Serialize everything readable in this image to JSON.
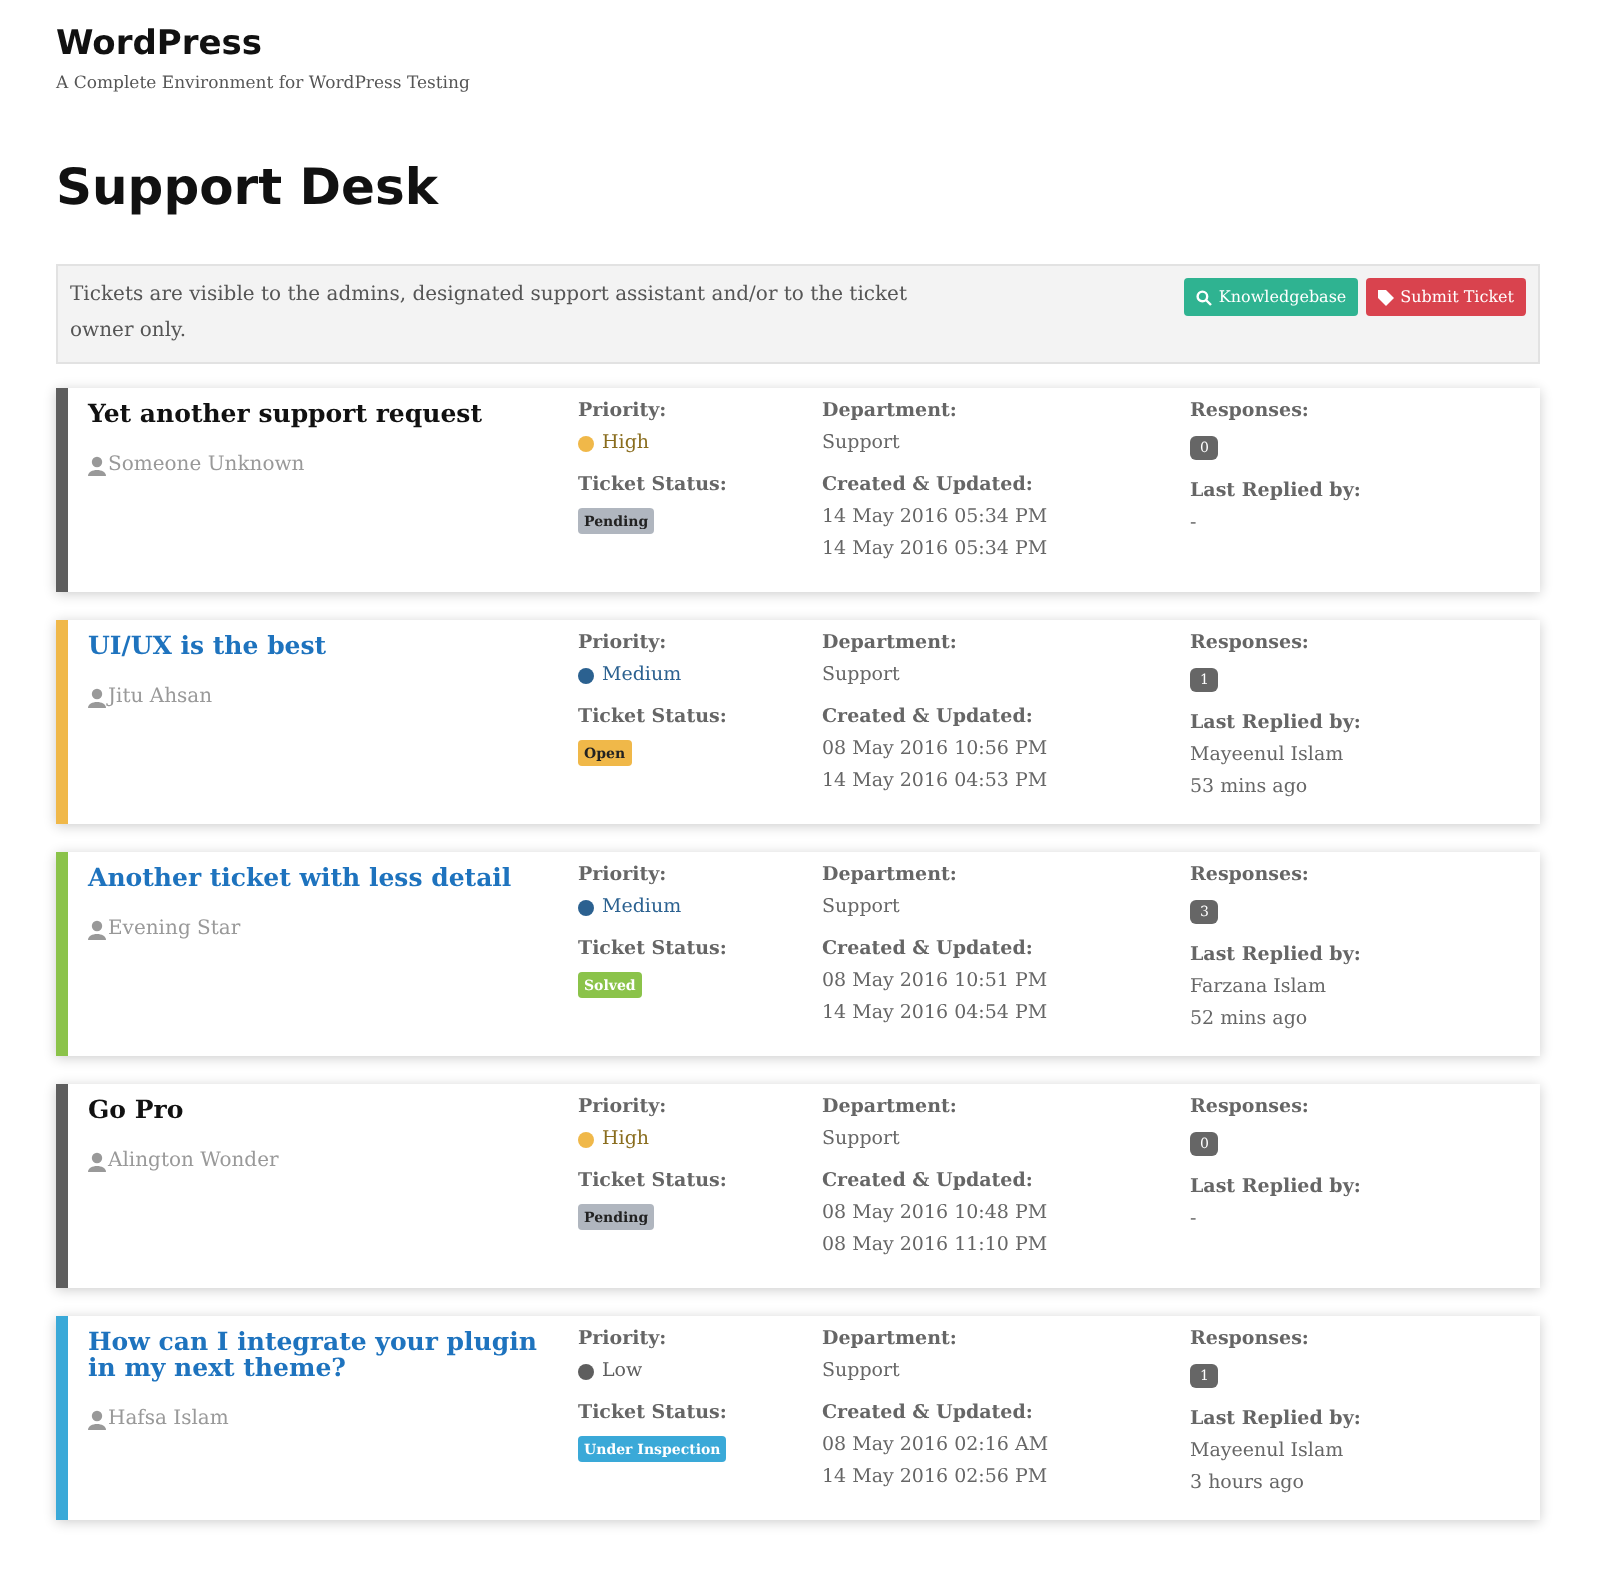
{
  "site": {
    "title": "WordPress",
    "tagline": "A Complete Environment for WordPress Testing"
  },
  "page_title": "Support Desk",
  "notice": {
    "text": "Tickets are visible to the admins, designated support assistant and/or to the ticket owner only.",
    "buttons": [
      {
        "label": "Knowledgebase",
        "kind": "knowledgebase"
      },
      {
        "label": "Submit Ticket",
        "kind": "submit"
      }
    ]
  },
  "tickets": [
    {
      "title": "Yet another support request",
      "highlighted": false,
      "color": "#5e5e5e",
      "author": "Someone Unknown",
      "labels": {
        "priority": "Priority:",
        "status": "Ticket Status:",
        "department": "Department:",
        "dates": "Created & Updated:",
        "responses": "Responses:",
        "last_replied": "Last Replied by:"
      },
      "priority": {
        "label": "High",
        "color": "#f0b849"
      },
      "status": {
        "label": "Pending",
        "color": "#b0b6bf"
      },
      "department": "Support",
      "created": "14 May 2016 05:34 PM",
      "updated": "14 May 2016 05:34 PM",
      "responses": "0",
      "last_replied": [
        "-"
      ]
    },
    {
      "title": "UI/UX is the best",
      "highlighted": true,
      "color": "#f0b849",
      "author": "Jitu Ahsan",
      "labels": {
        "priority": "Priority:",
        "status": "Ticket Status:",
        "department": "Department:",
        "dates": "Created & Updated:",
        "responses": "Responses:",
        "last_replied": "Last Replied by:"
      },
      "priority": {
        "label": "Medium",
        "color": "#2b6190"
      },
      "status": {
        "label": "Open",
        "color": "#f0b849"
      },
      "department": "Support",
      "created": "08 May 2016 10:56 PM",
      "updated": "14 May 2016 04:53 PM",
      "responses": "1",
      "last_replied": [
        "Mayeenul Islam",
        "53 mins ago"
      ]
    },
    {
      "title": "Another ticket with less detail",
      "highlighted": true,
      "color": "#8bc34a",
      "author": "Evening Star",
      "labels": {
        "priority": "Priority:",
        "status": "Ticket Status:",
        "department": "Department:",
        "dates": "Created & Updated:",
        "responses": "Responses:",
        "last_replied": "Last Replied by:"
      },
      "priority": {
        "label": "Medium",
        "color": "#2b6190"
      },
      "status": {
        "label": "Solved",
        "color": "#8bc34a"
      },
      "department": "Support",
      "created": "08 May 2016 10:51 PM",
      "updated": "14 May 2016 04:54 PM",
      "responses": "3",
      "last_replied": [
        "Farzana Islam",
        "52 mins ago"
      ]
    },
    {
      "title": "Go Pro",
      "highlighted": false,
      "color": "#5e5e5e",
      "author": "Alington Wonder",
      "labels": {
        "priority": "Priority:",
        "status": "Ticket Status:",
        "department": "Department:",
        "dates": "Created & Updated:",
        "responses": "Responses:",
        "last_replied": "Last Replied by:"
      },
      "priority": {
        "label": "High",
        "color": "#f0b849"
      },
      "status": {
        "label": "Pending",
        "color": "#b0b6bf"
      },
      "department": "Support",
      "created": "08 May 2016 10:48 PM",
      "updated": "08 May 2016 11:10 PM",
      "responses": "0",
      "last_replied": [
        "-"
      ]
    },
    {
      "title": "How can I integrate your plugin in my next theme?",
      "highlighted": true,
      "color": "#3aa9d8",
      "author": "Hafsa Islam",
      "labels": {
        "priority": "Priority:",
        "status": "Ticket Status:",
        "department": "Department:",
        "dates": "Created & Updated:",
        "responses": "Responses:",
        "last_replied": "Last Replied by:"
      },
      "priority": {
        "label": "Low",
        "color": "#5e5e5e"
      },
      "status": {
        "label": "Under Inspection",
        "color": "#3aa9d8"
      },
      "department": "Support",
      "created": "08 May 2016 02:16 AM",
      "updated": "14 May 2016 02:56 PM",
      "responses": "1",
      "last_replied": [
        "Mayeenul Islam",
        "3 hours ago"
      ]
    }
  ]
}
